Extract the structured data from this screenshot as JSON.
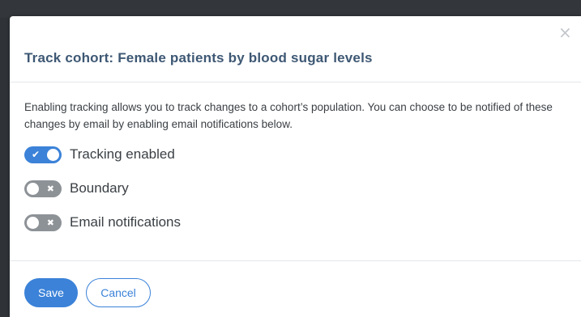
{
  "modal": {
    "title": "Track cohort: Female patients by blood sugar levels",
    "close_icon": "close-icon",
    "close_glyph": "×",
    "description": "Enabling tracking allows you to track changes to a cohort’s population. You can choose to be notified of these changes by email by enabling email notifications below."
  },
  "toggles": [
    {
      "label": "Tracking enabled",
      "state": "on",
      "glyph": "✔"
    },
    {
      "label": "Boundary",
      "state": "off",
      "glyph": "✖"
    },
    {
      "label": "Email notifications",
      "state": "off",
      "glyph": "✖"
    }
  ],
  "footer": {
    "save_label": "Save",
    "cancel_label": "Cancel"
  },
  "colors": {
    "accent": "#3b82d8",
    "title": "#3e5874",
    "toggle_off": "#8d9297"
  }
}
